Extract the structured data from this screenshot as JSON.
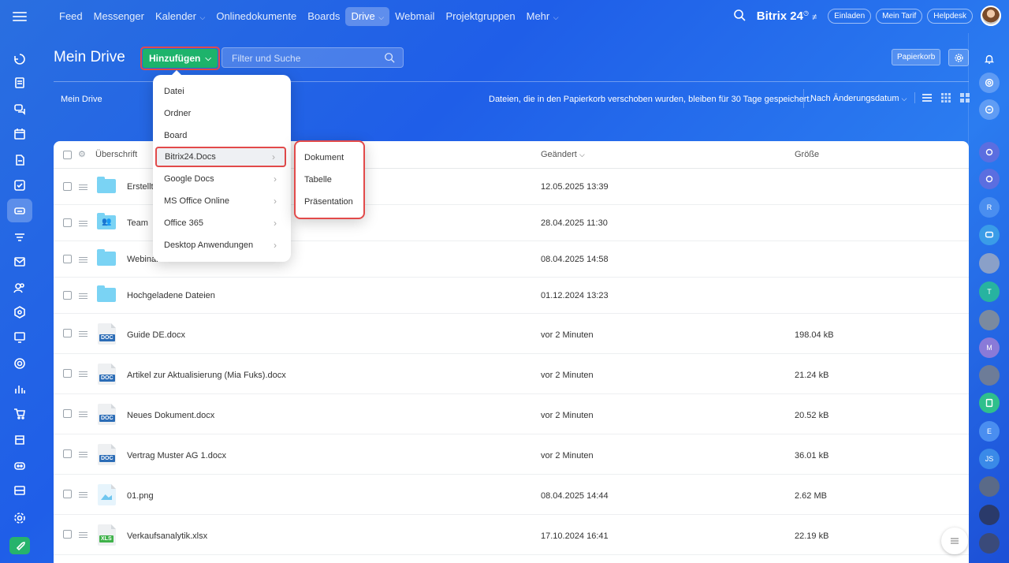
{
  "topbar": {
    "nav": [
      {
        "label": "Feed",
        "dropdown": false,
        "active": false
      },
      {
        "label": "Messenger",
        "dropdown": false,
        "active": false
      },
      {
        "label": "Kalender",
        "dropdown": true,
        "active": false
      },
      {
        "label": "Onlinedokumente",
        "dropdown": false,
        "active": false
      },
      {
        "label": "Boards",
        "dropdown": false,
        "active": false
      },
      {
        "label": "Drive",
        "dropdown": true,
        "active": true
      },
      {
        "label": "Webmail",
        "dropdown": false,
        "active": false
      },
      {
        "label": "Projektgruppen",
        "dropdown": false,
        "active": false
      },
      {
        "label": "Mehr",
        "dropdown": true,
        "active": false
      }
    ],
    "brand": "Bitrix 24",
    "buttons": [
      "Einladen",
      "Mein Tarif",
      "Helpdesk"
    ]
  },
  "header": {
    "title": "Mein Drive",
    "add_button": "Hinzufügen",
    "search_placeholder": "Filter und Suche",
    "trash_button": "Papierkorb",
    "breadcrumb": "Mein Drive",
    "info": "Dateien, die in den Papierkorb verschoben wurden, bleiben für 30 Tage gespeichert.",
    "sort": "Nach Änderungsdatum"
  },
  "table": {
    "columns": {
      "name": "Überschrift",
      "modified": "Geändert",
      "size": "Größe"
    },
    "rows": [
      {
        "name": "Erstellt",
        "type": "folder",
        "date": "12.05.2025 13:39",
        "size": ""
      },
      {
        "name": "Team",
        "type": "folder-shared",
        "date": "28.04.2025 11:30",
        "size": ""
      },
      {
        "name": "Webinar",
        "type": "folder",
        "date": "08.04.2025 14:58",
        "size": ""
      },
      {
        "name": "Hochgeladene Dateien",
        "type": "folder",
        "date": "01.12.2024 13:23",
        "size": ""
      },
      {
        "name": "Guide DE.docx",
        "type": "doc",
        "date": "vor 2 Minuten",
        "size": "198.04 kB"
      },
      {
        "name": "Artikel zur Aktualisierung (Mia Fuks).docx",
        "type": "doc",
        "date": "vor 2 Minuten",
        "size": "21.24 kB"
      },
      {
        "name": "Neues Dokument.docx",
        "type": "doc",
        "date": "vor 2 Minuten",
        "size": "20.52 kB"
      },
      {
        "name": "Vertrag Muster AG 1.docx",
        "type": "doc",
        "date": "vor 2 Minuten",
        "size": "36.01 kB"
      },
      {
        "name": "01.png",
        "type": "image",
        "date": "08.04.2025 14:44",
        "size": "2.62 MB"
      },
      {
        "name": "Verkaufsanalytik.xlsx",
        "type": "xls",
        "date": "17.10.2024 16:41",
        "size": "22.19 kB"
      }
    ]
  },
  "add_menu": {
    "items": [
      {
        "label": "Datei",
        "submenu": false
      },
      {
        "label": "Ordner",
        "submenu": false
      },
      {
        "label": "Board",
        "submenu": false
      },
      {
        "label": "Bitrix24.Docs",
        "submenu": true,
        "highlighted": true
      },
      {
        "label": "Google Docs",
        "submenu": true
      },
      {
        "label": "MS Office Online",
        "submenu": true
      },
      {
        "label": "Office 365",
        "submenu": true
      },
      {
        "label": "Desktop Anwendungen",
        "submenu": true
      }
    ],
    "submenu_items": [
      "Dokument",
      "Tabelle",
      "Präsentation"
    ]
  },
  "badges": {
    "doc": "DOC",
    "xls": "XLS"
  },
  "right_avatars": [
    "R",
    "T",
    "M",
    "E",
    "JS"
  ],
  "colors": {
    "accent_green": "#1db36b",
    "highlight_red": "#e24a4a",
    "folder": "#7ad3f4",
    "doc_badge": "#2b6cb6",
    "xls_badge": "#3fb24a"
  }
}
